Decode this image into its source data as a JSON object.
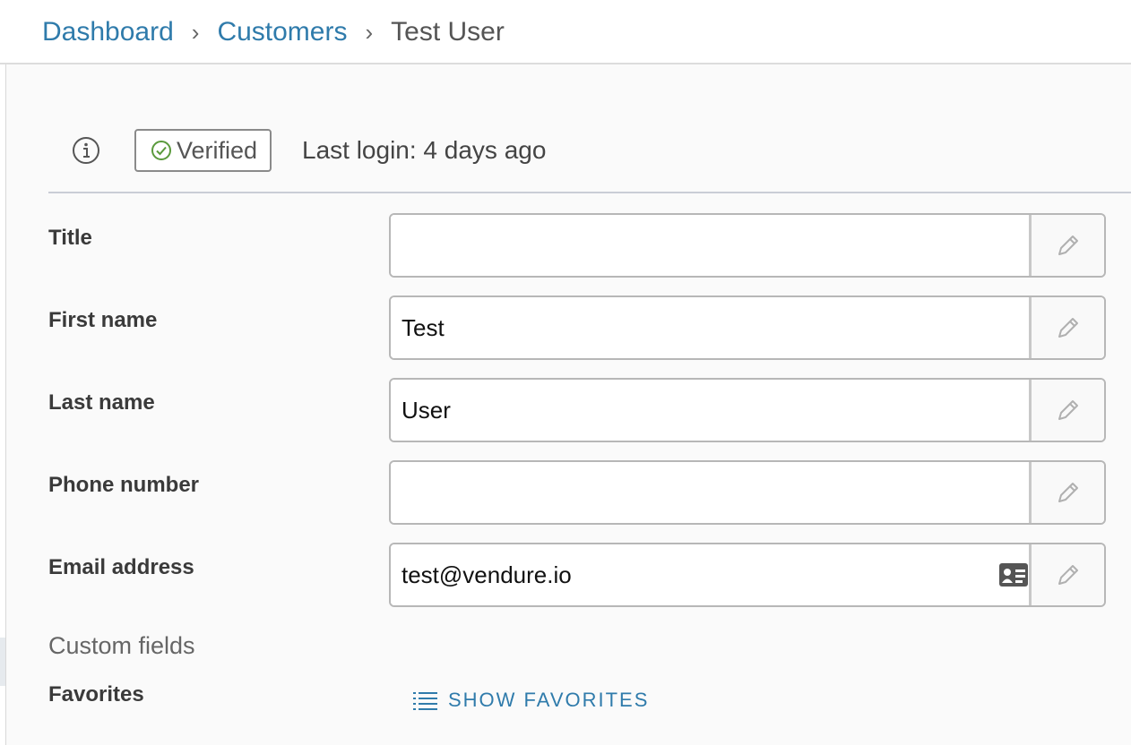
{
  "breadcrumb": {
    "items": [
      "Dashboard",
      "Customers"
    ],
    "separator": "›",
    "current": "Test User"
  },
  "status": {
    "info_icon": "info-icon",
    "verified_label": "Verified",
    "verified_icon": "check-circle-icon",
    "last_login": "Last login: 4 days ago"
  },
  "form": {
    "fields": [
      {
        "label": "Title",
        "value": ""
      },
      {
        "label": "First name",
        "value": "Test"
      },
      {
        "label": "Last name",
        "value": "User"
      },
      {
        "label": "Phone number",
        "value": ""
      },
      {
        "label": "Email address",
        "value": "test@vendure.io"
      }
    ],
    "edit_icon": "pencil-icon",
    "email_card_icon": "id-card-icon"
  },
  "custom_fields": {
    "heading": "Custom fields",
    "favorites_label": "Favorites",
    "show_favorites_label": "SHOW FAVORITES",
    "list_icon": "list-icon"
  },
  "colors": {
    "link": "#2f7bab",
    "verified_check": "#5a9a3c",
    "background": "#fafafa"
  }
}
